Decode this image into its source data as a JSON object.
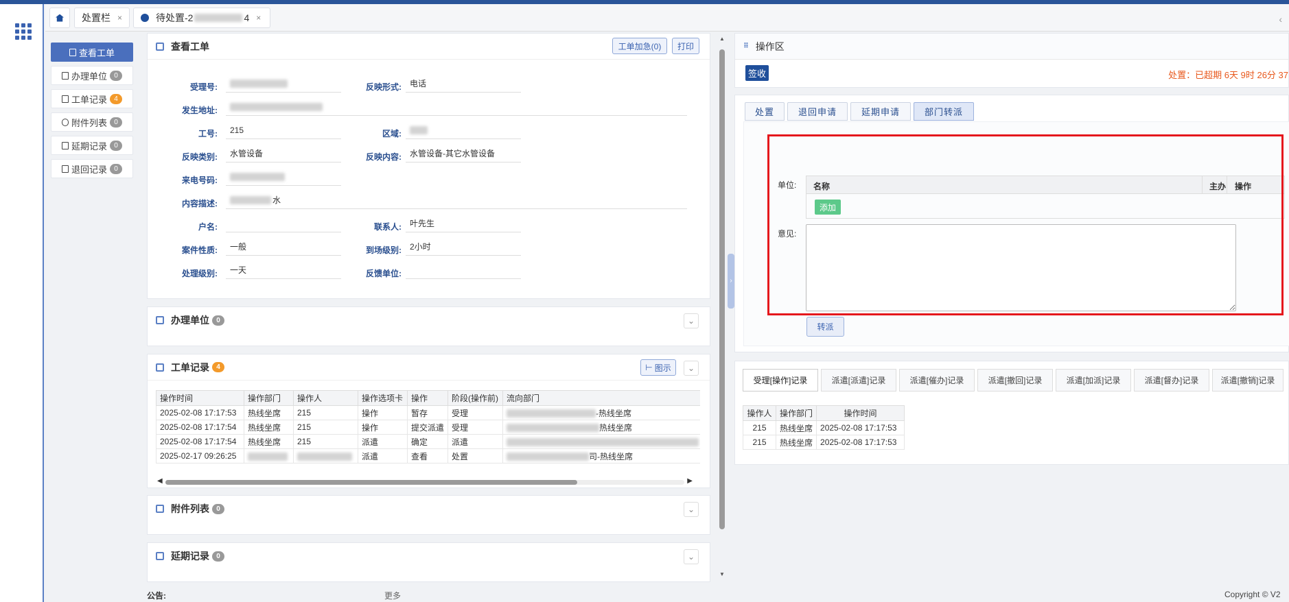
{
  "tabs": {
    "home_icon": "home-icon",
    "tab1": "处置栏",
    "tab2": "待处置-2",
    "tab2_suffix": "4",
    "close": "×",
    "collapse": "‹"
  },
  "sidenav": {
    "items": [
      {
        "label": "查看工单",
        "badge": ""
      },
      {
        "label": "办理单位",
        "badge": "0"
      },
      {
        "label": "工单记录",
        "badge": "4"
      },
      {
        "label": "附件列表",
        "badge": "0"
      },
      {
        "label": "延期记录",
        "badge": "0"
      },
      {
        "label": "退回记录",
        "badge": "0"
      }
    ]
  },
  "workorder": {
    "title": "查看工单",
    "urgent_btn": "工单加急(0)",
    "print_btn": "打印",
    "fields": {
      "accept_no_label": "受理号:",
      "accept_no": "",
      "form_label": "反映形式:",
      "form": "电话",
      "address_label": "发生地址:",
      "address": "",
      "job_no_label": "工号:",
      "job_no": "215",
      "area_label": "区域:",
      "area": "",
      "category_label": "反映类别:",
      "category": "水管设备",
      "content_label": "反映内容:",
      "content": "水管设备-其它水管设备",
      "phone_label": "来电号码:",
      "phone": "",
      "desc_label": "内容描述:",
      "desc": "水",
      "household_label": "户名:",
      "household": "",
      "contact_label": "联系人:",
      "contact": "叶先生",
      "nature_label": "案件性质:",
      "nature": "一般",
      "arrival_label": "到场级别:",
      "arrival": "2小时",
      "level_label": "处理级别:",
      "level": "一天",
      "unit_label": "反馈单位:",
      "unit": ""
    }
  },
  "handling_units": {
    "title": "办理单位",
    "count": "0"
  },
  "records": {
    "title": "工单记录",
    "count": "4",
    "chart_btn": "图示",
    "headers": [
      "操作时间",
      "操作部门",
      "操作人",
      "操作选项卡",
      "操作",
      "阶段(操作前)",
      "流向部门"
    ],
    "rows": [
      [
        "2025-02-08 17:17:53",
        "热线坐席",
        "215",
        "操作",
        "暂存",
        "受理",
        "-热线坐席"
      ],
      [
        "2025-02-08 17:17:54",
        "热线坐席",
        "215",
        "操作",
        "提交派遣",
        "受理",
        "热线坐席"
      ],
      [
        "2025-02-08 17:17:54",
        "热线坐席",
        "215",
        "派遣",
        "确定",
        "派遣",
        ""
      ],
      [
        "2025-02-17 09:26:25",
        "",
        "",
        "派遣",
        "查看",
        "处置",
        "司-热线坐席"
      ]
    ]
  },
  "attachments": {
    "title": "附件列表",
    "count": "0"
  },
  "extensions": {
    "title": "延期记录",
    "count": "0"
  },
  "operation": {
    "title": "操作区",
    "sign_btn": "签收",
    "overdue": "处置：已超期 6天 9时 26分 37"
  },
  "optabs": [
    "处置",
    "退回申请",
    "延期申请",
    "部门转派"
  ],
  "transfer": {
    "unit_label": "单位:",
    "col_name": "名称",
    "col_main": "主办",
    "col_op": "操作",
    "add_btn": "添加",
    "opinion_label": "意见:",
    "opinion_value": "",
    "transfer_btn": "转派"
  },
  "record_tabs": [
    "受理[操作]记录",
    "派遣[派遣]记录",
    "派遣[催办]记录",
    "派遣[撤回]记录",
    "派遣[加派]记录",
    "派遣[督办]记录",
    "派遣[撤销]记录"
  ],
  "accept_records": {
    "headers": [
      "操作人",
      "操作部门",
      "操作时间"
    ],
    "rows": [
      [
        "215",
        "热线坐席",
        "2025-02-08 17:17:53"
      ],
      [
        "215",
        "热线坐席",
        "2025-02-08 17:17:53"
      ]
    ]
  },
  "footer": {
    "notice_label": "公告:",
    "more": "更多",
    "copyright": "Copyright © V2"
  }
}
